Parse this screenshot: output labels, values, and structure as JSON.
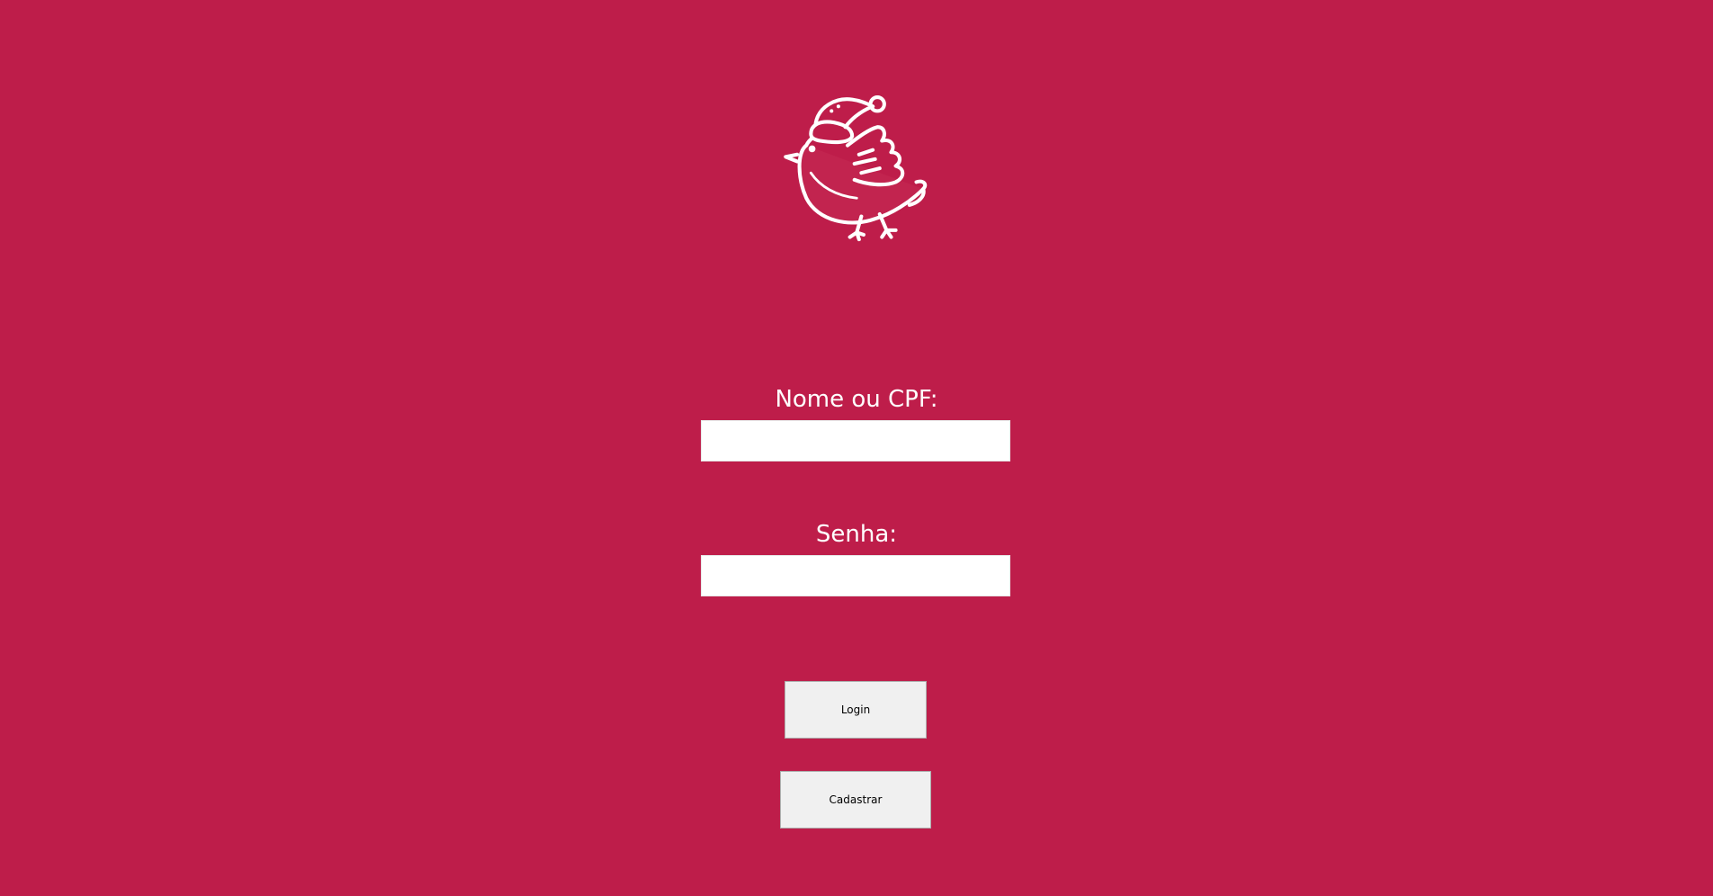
{
  "window": {
    "background_color": "#be1d4a"
  },
  "logo": {
    "icon": "robin-bird-santa-hat-icon"
  },
  "form": {
    "username_label": "Nome ou CPF:",
    "username_value": "",
    "password_label": "Senha:",
    "password_value": ""
  },
  "buttons": {
    "login_label": "Login",
    "register_label": "Cadastrar"
  }
}
